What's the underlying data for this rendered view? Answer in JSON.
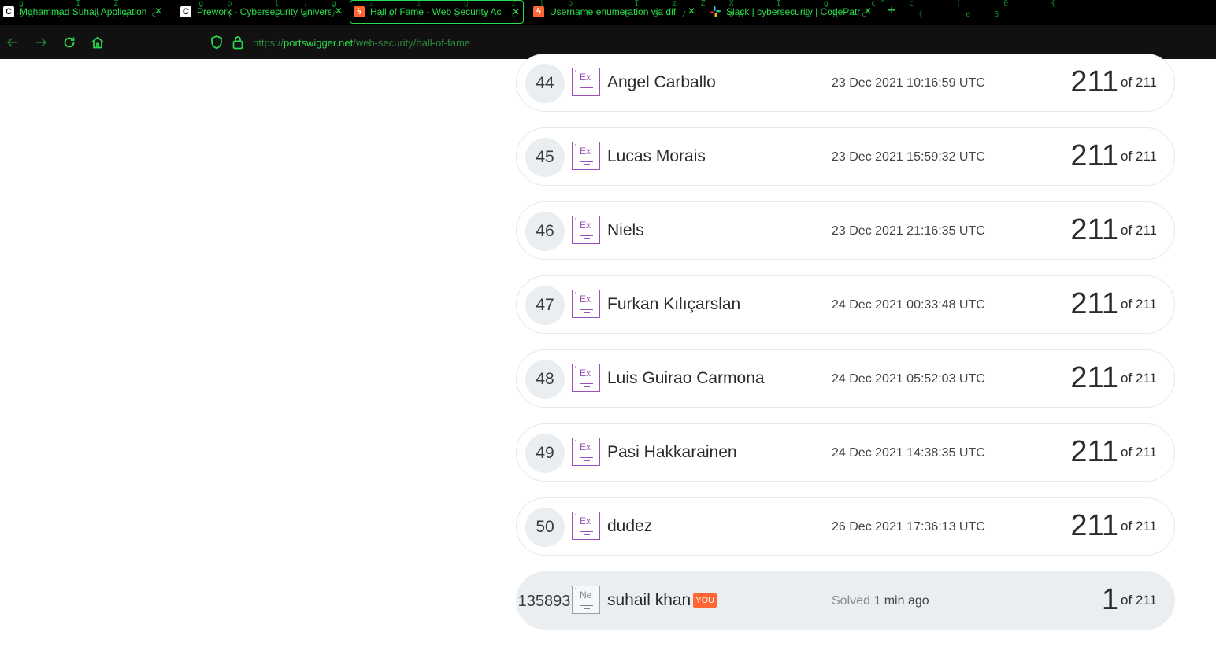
{
  "tabs": [
    {
      "title": "Mohammad Suhail Application",
      "favicon": "codepath-c-icon",
      "active": false
    },
    {
      "title": "Prework - Cybersecurity Univers",
      "favicon": "codepath-c-icon",
      "active": false
    },
    {
      "title": "Hall of Fame - Web Security Ac",
      "favicon": "portswigger-icon",
      "active": true
    },
    {
      "title": "Username enumeration via dif",
      "favicon": "portswigger-icon",
      "active": false
    },
    {
      "title": "Slack | cybersecurity | CodePath",
      "favicon": "slack-icon",
      "active": false
    }
  ],
  "newtab_label": "+",
  "address": {
    "scheme": "https://",
    "host": "portswigger.net",
    "path": "/web-security/hall-of-fame"
  },
  "leaderboard": [
    {
      "rank": "44",
      "badge": "Ex",
      "name": "Angel Carballo",
      "time": "23 Dec 2021 10:16:59 UTC",
      "score": "211",
      "total": "of 211"
    },
    {
      "rank": "45",
      "badge": "Ex",
      "name": "Lucas Morais",
      "time": "23 Dec 2021 15:59:32 UTC",
      "score": "211",
      "total": "of 211"
    },
    {
      "rank": "46",
      "badge": "Ex",
      "name": "Niels",
      "time": "23 Dec 2021 21:16:35 UTC",
      "score": "211",
      "total": "of 211"
    },
    {
      "rank": "47",
      "badge": "Ex",
      "name": "Furkan Kılıçarslan",
      "time": "24 Dec 2021 00:33:48 UTC",
      "score": "211",
      "total": "of 211"
    },
    {
      "rank": "48",
      "badge": "Ex",
      "name": "Luis Guirao Carmona",
      "time": "24 Dec 2021 05:52:03 UTC",
      "score": "211",
      "total": "of 211"
    },
    {
      "rank": "49",
      "badge": "Ex",
      "name": "Pasi Hakkarainen",
      "time": "24 Dec 2021 14:38:35 UTC",
      "score": "211",
      "total": "of 211"
    },
    {
      "rank": "50",
      "badge": "Ex",
      "name": "dudez",
      "time": "26 Dec 2021 17:36:13 UTC",
      "score": "211",
      "total": "of 211"
    }
  ],
  "current_user": {
    "rank": "135893",
    "badge": "Ne",
    "name": "suhail khan",
    "you_label": "YOU",
    "solved_label": "Solved",
    "solved_time": "1 min ago",
    "score": "1",
    "total": "of 211"
  },
  "colors": {
    "accent": "#ff6633",
    "badge_expert": "#9b4fb8",
    "chrome_green": "#2bdc4a"
  }
}
